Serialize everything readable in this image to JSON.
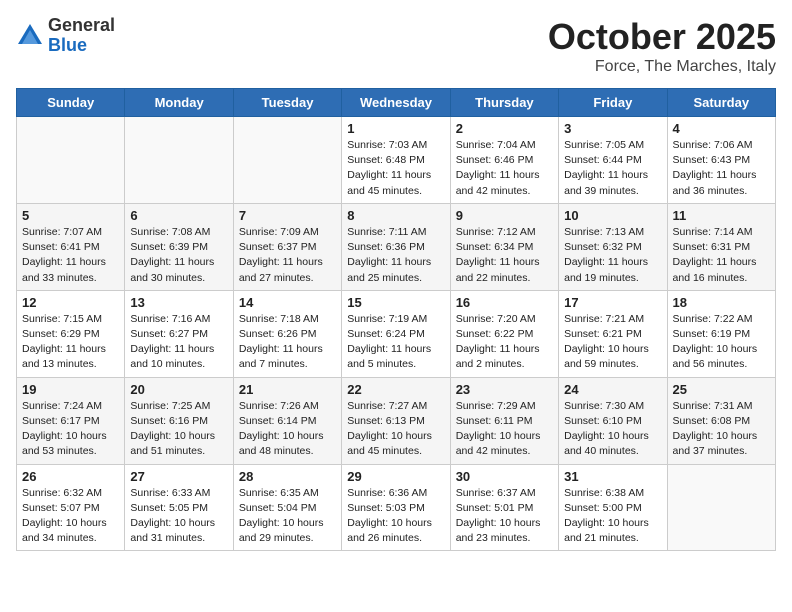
{
  "logo": {
    "general": "General",
    "blue": "Blue"
  },
  "title": "October 2025",
  "location": "Force, The Marches, Italy",
  "days_of_week": [
    "Sunday",
    "Monday",
    "Tuesday",
    "Wednesday",
    "Thursday",
    "Friday",
    "Saturday"
  ],
  "weeks": [
    [
      {
        "day": "",
        "info": ""
      },
      {
        "day": "",
        "info": ""
      },
      {
        "day": "",
        "info": ""
      },
      {
        "day": "1",
        "info": "Sunrise: 7:03 AM\nSunset: 6:48 PM\nDaylight: 11 hours and 45 minutes."
      },
      {
        "day": "2",
        "info": "Sunrise: 7:04 AM\nSunset: 6:46 PM\nDaylight: 11 hours and 42 minutes."
      },
      {
        "day": "3",
        "info": "Sunrise: 7:05 AM\nSunset: 6:44 PM\nDaylight: 11 hours and 39 minutes."
      },
      {
        "day": "4",
        "info": "Sunrise: 7:06 AM\nSunset: 6:43 PM\nDaylight: 11 hours and 36 minutes."
      }
    ],
    [
      {
        "day": "5",
        "info": "Sunrise: 7:07 AM\nSunset: 6:41 PM\nDaylight: 11 hours and 33 minutes."
      },
      {
        "day": "6",
        "info": "Sunrise: 7:08 AM\nSunset: 6:39 PM\nDaylight: 11 hours and 30 minutes."
      },
      {
        "day": "7",
        "info": "Sunrise: 7:09 AM\nSunset: 6:37 PM\nDaylight: 11 hours and 27 minutes."
      },
      {
        "day": "8",
        "info": "Sunrise: 7:11 AM\nSunset: 6:36 PM\nDaylight: 11 hours and 25 minutes."
      },
      {
        "day": "9",
        "info": "Sunrise: 7:12 AM\nSunset: 6:34 PM\nDaylight: 11 hours and 22 minutes."
      },
      {
        "day": "10",
        "info": "Sunrise: 7:13 AM\nSunset: 6:32 PM\nDaylight: 11 hours and 19 minutes."
      },
      {
        "day": "11",
        "info": "Sunrise: 7:14 AM\nSunset: 6:31 PM\nDaylight: 11 hours and 16 minutes."
      }
    ],
    [
      {
        "day": "12",
        "info": "Sunrise: 7:15 AM\nSunset: 6:29 PM\nDaylight: 11 hours and 13 minutes."
      },
      {
        "day": "13",
        "info": "Sunrise: 7:16 AM\nSunset: 6:27 PM\nDaylight: 11 hours and 10 minutes."
      },
      {
        "day": "14",
        "info": "Sunrise: 7:18 AM\nSunset: 6:26 PM\nDaylight: 11 hours and 7 minutes."
      },
      {
        "day": "15",
        "info": "Sunrise: 7:19 AM\nSunset: 6:24 PM\nDaylight: 11 hours and 5 minutes."
      },
      {
        "day": "16",
        "info": "Sunrise: 7:20 AM\nSunset: 6:22 PM\nDaylight: 11 hours and 2 minutes."
      },
      {
        "day": "17",
        "info": "Sunrise: 7:21 AM\nSunset: 6:21 PM\nDaylight: 10 hours and 59 minutes."
      },
      {
        "day": "18",
        "info": "Sunrise: 7:22 AM\nSunset: 6:19 PM\nDaylight: 10 hours and 56 minutes."
      }
    ],
    [
      {
        "day": "19",
        "info": "Sunrise: 7:24 AM\nSunset: 6:17 PM\nDaylight: 10 hours and 53 minutes."
      },
      {
        "day": "20",
        "info": "Sunrise: 7:25 AM\nSunset: 6:16 PM\nDaylight: 10 hours and 51 minutes."
      },
      {
        "day": "21",
        "info": "Sunrise: 7:26 AM\nSunset: 6:14 PM\nDaylight: 10 hours and 48 minutes."
      },
      {
        "day": "22",
        "info": "Sunrise: 7:27 AM\nSunset: 6:13 PM\nDaylight: 10 hours and 45 minutes."
      },
      {
        "day": "23",
        "info": "Sunrise: 7:29 AM\nSunset: 6:11 PM\nDaylight: 10 hours and 42 minutes."
      },
      {
        "day": "24",
        "info": "Sunrise: 7:30 AM\nSunset: 6:10 PM\nDaylight: 10 hours and 40 minutes."
      },
      {
        "day": "25",
        "info": "Sunrise: 7:31 AM\nSunset: 6:08 PM\nDaylight: 10 hours and 37 minutes."
      }
    ],
    [
      {
        "day": "26",
        "info": "Sunrise: 6:32 AM\nSunset: 5:07 PM\nDaylight: 10 hours and 34 minutes."
      },
      {
        "day": "27",
        "info": "Sunrise: 6:33 AM\nSunset: 5:05 PM\nDaylight: 10 hours and 31 minutes."
      },
      {
        "day": "28",
        "info": "Sunrise: 6:35 AM\nSunset: 5:04 PM\nDaylight: 10 hours and 29 minutes."
      },
      {
        "day": "29",
        "info": "Sunrise: 6:36 AM\nSunset: 5:03 PM\nDaylight: 10 hours and 26 minutes."
      },
      {
        "day": "30",
        "info": "Sunrise: 6:37 AM\nSunset: 5:01 PM\nDaylight: 10 hours and 23 minutes."
      },
      {
        "day": "31",
        "info": "Sunrise: 6:38 AM\nSunset: 5:00 PM\nDaylight: 10 hours and 21 minutes."
      },
      {
        "day": "",
        "info": ""
      }
    ]
  ]
}
